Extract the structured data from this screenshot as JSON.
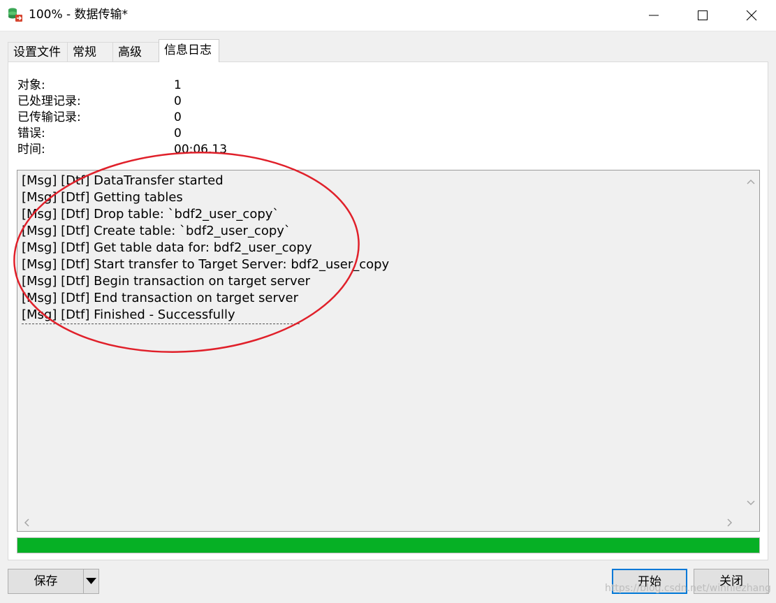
{
  "window": {
    "title": "100% - 数据传输*",
    "icon": "database-transfer-icon",
    "controls": [
      "minimize-icon",
      "maximize-icon",
      "close-icon"
    ]
  },
  "tabs": [
    {
      "label": "设置文件",
      "active": false
    },
    {
      "label": "常规",
      "active": false
    },
    {
      "label": "高级",
      "active": false
    },
    {
      "label": "信息日志",
      "active": true
    }
  ],
  "stats": [
    {
      "label": "对象:",
      "value": "1"
    },
    {
      "label": "已处理记录:",
      "value": "0"
    },
    {
      "label": "已传输记录:",
      "value": "0"
    },
    {
      "label": "错误:",
      "value": "0"
    },
    {
      "label": "时间:",
      "value": "00:06.13"
    }
  ],
  "log": {
    "lines": [
      "[Msg] [Dtf] DataTransfer started",
      "[Msg] [Dtf] Getting tables",
      "[Msg] [Dtf] Drop table: `bdf2_user_copy`",
      "[Msg] [Dtf] Create table: `bdf2_user_copy`",
      "[Msg] [Dtf] Get table data for: bdf2_user_copy",
      "[Msg] [Dtf] Start transfer to Target Server: bdf2_user_copy",
      "[Msg] [Dtf] Begin transaction on target server",
      "[Msg] [Dtf] End transaction on target server",
      "[Msg] [Dtf] Finished - Successfully"
    ]
  },
  "progress": {
    "percent": 100,
    "color": "#06b025"
  },
  "buttons": {
    "save": "保存",
    "start": "开始",
    "close": "关闭"
  },
  "annotation": {
    "shape": "ellipse",
    "color": "#e0202a"
  },
  "watermark": "https://blog.csdn.net/winniezhang"
}
